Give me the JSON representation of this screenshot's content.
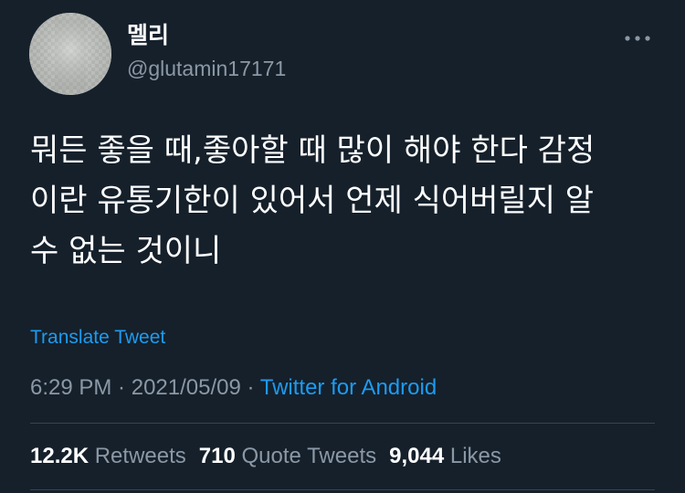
{
  "user": {
    "display_name": "멜리",
    "handle": "@glutamin17171"
  },
  "more_icon": "more-horizontal-icon",
  "tweet": {
    "text": "뭐든 좋을 때,좋아할 때 많이 해야 한다 감정\n이란 유통기한이 있어서 언제 식어버릴지 알\n수 없는 것이니",
    "translate_label": "Translate Tweet",
    "time": "6:29 PM",
    "separator": " · ",
    "date": "2021/05/09",
    "source": "Twitter for Android"
  },
  "stats": {
    "retweets_count": "12.2K",
    "retweets_label": "Retweets",
    "quotes_count": "710",
    "quotes_label": "Quote Tweets",
    "likes_count": "9,044",
    "likes_label": "Likes"
  },
  "colors": {
    "background": "#15202b",
    "accent": "#1d9bf0",
    "secondary_text": "#8b98a5",
    "divider": "#38444d"
  }
}
